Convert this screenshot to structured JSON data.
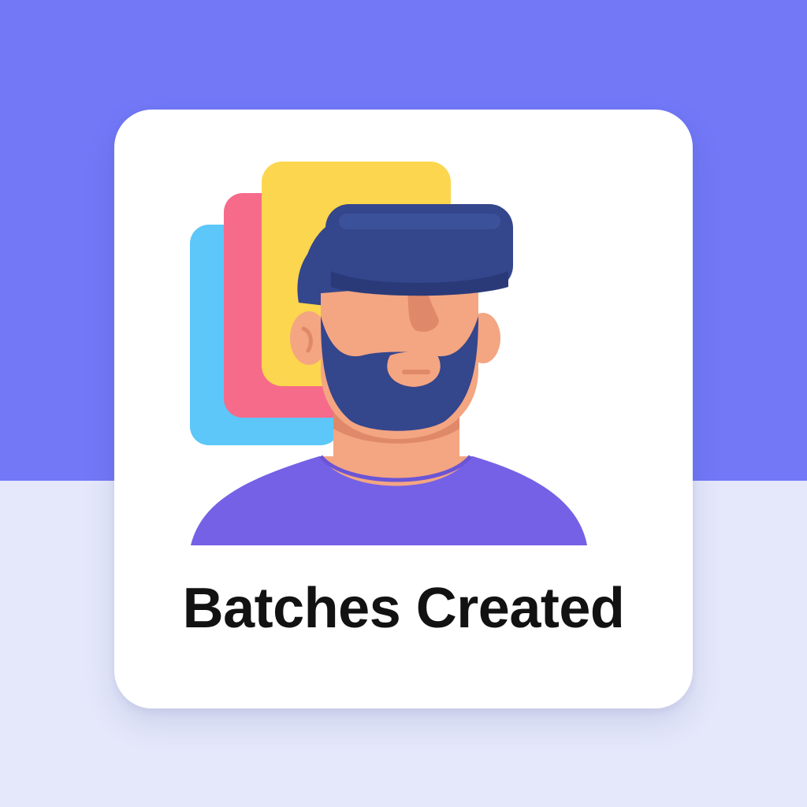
{
  "card": {
    "title": "Batches Created"
  },
  "colors": {
    "background_top": "#7278f6",
    "background_bottom": "#e5e8fb",
    "card": "#ffffff",
    "title_text": "#121212",
    "sheet_blue": "#5cc7f8",
    "sheet_pink": "#f66b8a",
    "sheet_yellow": "#fcd64e",
    "headset": "#34468c",
    "beard": "#34468c",
    "skin": "#f4a582",
    "shirt": "#7561e6"
  },
  "icons": {
    "illustration": "vr-headset-person-with-stacked-sheets-icon"
  }
}
